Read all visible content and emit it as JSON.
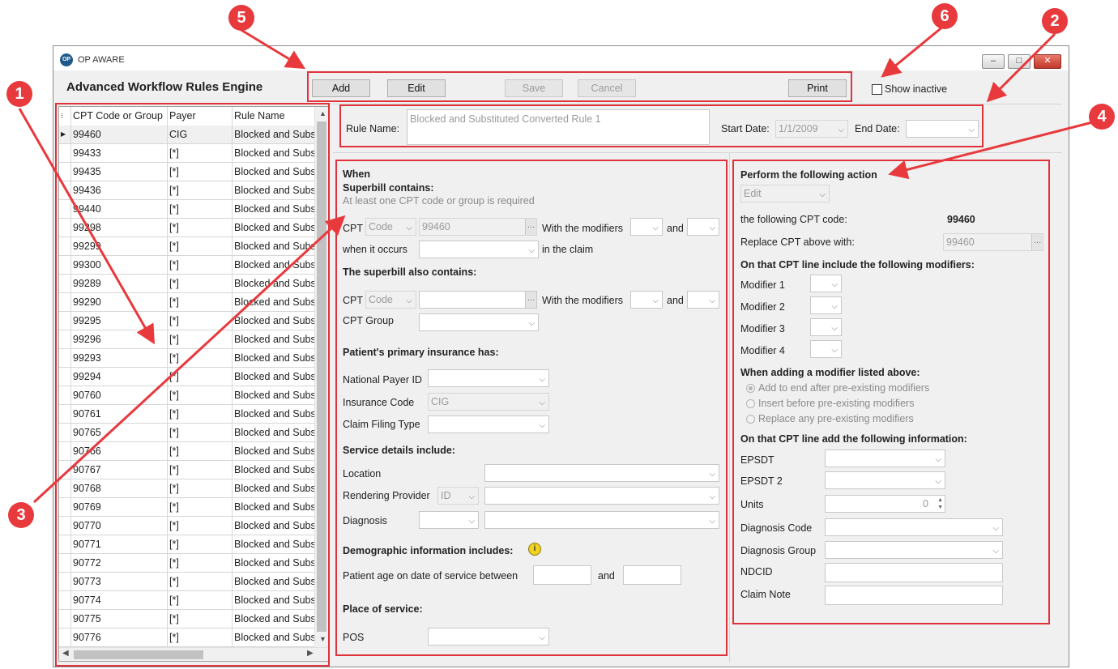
{
  "window": {
    "title": "OP AWARE",
    "app_title": "Advanced Workflow Rules Engine",
    "controls": {
      "minimize": "–",
      "maximize": "□",
      "close": "✕"
    }
  },
  "toolbar": {
    "add": "Add",
    "edit": "Edit",
    "save": "Save",
    "cancel": "Cancel",
    "print": "Print",
    "show_inactive": "Show inactive"
  },
  "grid": {
    "columns": [
      "CPT Code or Group",
      "Payer",
      "Rule Name"
    ],
    "rows": [
      [
        "99460",
        "CIG",
        "Blocked and Substituted"
      ],
      [
        "99433",
        "[*]",
        "Blocked and Substituted"
      ],
      [
        "99435",
        "[*]",
        "Blocked and Substituted"
      ],
      [
        "99436",
        "[*]",
        "Blocked and Substituted"
      ],
      [
        "99440",
        "[*]",
        "Blocked and Substituted"
      ],
      [
        "99298",
        "[*]",
        "Blocked and Substituted"
      ],
      [
        "99299",
        "[*]",
        "Blocked and Substituted"
      ],
      [
        "99300",
        "[*]",
        "Blocked and Substituted"
      ],
      [
        "99289",
        "[*]",
        "Blocked and Substituted"
      ],
      [
        "99290",
        "[*]",
        "Blocked and Substituted"
      ],
      [
        "99295",
        "[*]",
        "Blocked and Substituted"
      ],
      [
        "99296",
        "[*]",
        "Blocked and Substituted"
      ],
      [
        "99293",
        "[*]",
        "Blocked and Substituted"
      ],
      [
        "99294",
        "[*]",
        "Blocked and Substituted"
      ],
      [
        "90760",
        "[*]",
        "Blocked and Substituted"
      ],
      [
        "90761",
        "[*]",
        "Blocked and Substituted"
      ],
      [
        "90765",
        "[*]",
        "Blocked and Substituted"
      ],
      [
        "90766",
        "[*]",
        "Blocked and Substituted"
      ],
      [
        "90767",
        "[*]",
        "Blocked and Substituted"
      ],
      [
        "90768",
        "[*]",
        "Blocked and Substituted"
      ],
      [
        "90769",
        "[*]",
        "Blocked and Substituted"
      ],
      [
        "90770",
        "[*]",
        "Blocked and Substituted"
      ],
      [
        "90771",
        "[*]",
        "Blocked and Substituted"
      ],
      [
        "90772",
        "[*]",
        "Blocked and Substituted"
      ],
      [
        "90773",
        "[*]",
        "Blocked and Substituted"
      ],
      [
        "90774",
        "[*]",
        "Blocked and Substituted"
      ],
      [
        "90775",
        "[*]",
        "Blocked and Substituted"
      ],
      [
        "90776",
        "[*]",
        "Blocked and Substituted"
      ]
    ]
  },
  "rule_header": {
    "rule_name_label": "Rule Name:",
    "rule_name_value": "Blocked and Substituted Converted Rule 1",
    "start_date_label": "Start Date:",
    "start_date_value": "1/1/2009",
    "end_date_label": "End Date:",
    "end_date_value": ""
  },
  "when": {
    "heading": "When",
    "superbill_contains": "Superbill contains:",
    "hint": "At least one CPT code or group is required",
    "cpt_label": "CPT",
    "code_type": "Code",
    "cpt_value": "99460",
    "with_modifiers": "With the modifiers",
    "and": "and",
    "when_it_occurs": "when it occurs",
    "in_the_claim": "in the claim",
    "also_contains": "The superbill also contains:",
    "cpt2_label": "CPT",
    "code_type2": "Code",
    "with_modifiers2": "With the modifiers",
    "and2": "and",
    "cpt_group_label": "CPT Group",
    "primary_insurance": "Patient's primary insurance has:",
    "national_payer_id": "National Payer ID",
    "insurance_code": "Insurance Code",
    "insurance_code_value": "CIG",
    "claim_filing_type": "Claim Filing Type",
    "service_details": "Service details include:",
    "location": "Location",
    "rendering_provider": "Rendering Provider",
    "rendering_provider_type": "ID",
    "diagnosis": "Diagnosis",
    "demographic": "Demographic information includes:",
    "age_between": "Patient age on date of service between",
    "and3": "and",
    "place_of_service": "Place of service:",
    "pos": "POS"
  },
  "action": {
    "heading": "Perform the following action",
    "action_value": "Edit",
    "following_cpt_label": "the following CPT code:",
    "following_cpt_value": "99460",
    "replace_label": "Replace CPT above with:",
    "replace_value": "99460",
    "modifiers_heading": "On that CPT line include the following modifiers:",
    "modifier1": "Modifier 1",
    "modifier2": "Modifier 2",
    "modifier3": "Modifier 3",
    "modifier4": "Modifier 4",
    "adding_heading": "When adding a modifier listed above:",
    "opt_add_end": "Add to end after pre-existing modifiers",
    "opt_insert_before": "Insert before pre-existing modifiers",
    "opt_replace": "Replace any pre-existing modifiers",
    "info_heading": "On that CPT line add the following information:",
    "epsdt": "EPSDT",
    "epsdt2": "EPSDT 2",
    "units": "Units",
    "units_value": "0",
    "diagnosis_code": "Diagnosis Code",
    "diagnosis_group": "Diagnosis Group",
    "ndcid": "NDCID",
    "claim_note": "Claim Note"
  },
  "callouts": [
    "1",
    "2",
    "3",
    "4",
    "5",
    "6"
  ],
  "colors": {
    "callout": "#e8393d",
    "highlight_box": "#e0323b",
    "window_bg": "#f0f0f0"
  }
}
